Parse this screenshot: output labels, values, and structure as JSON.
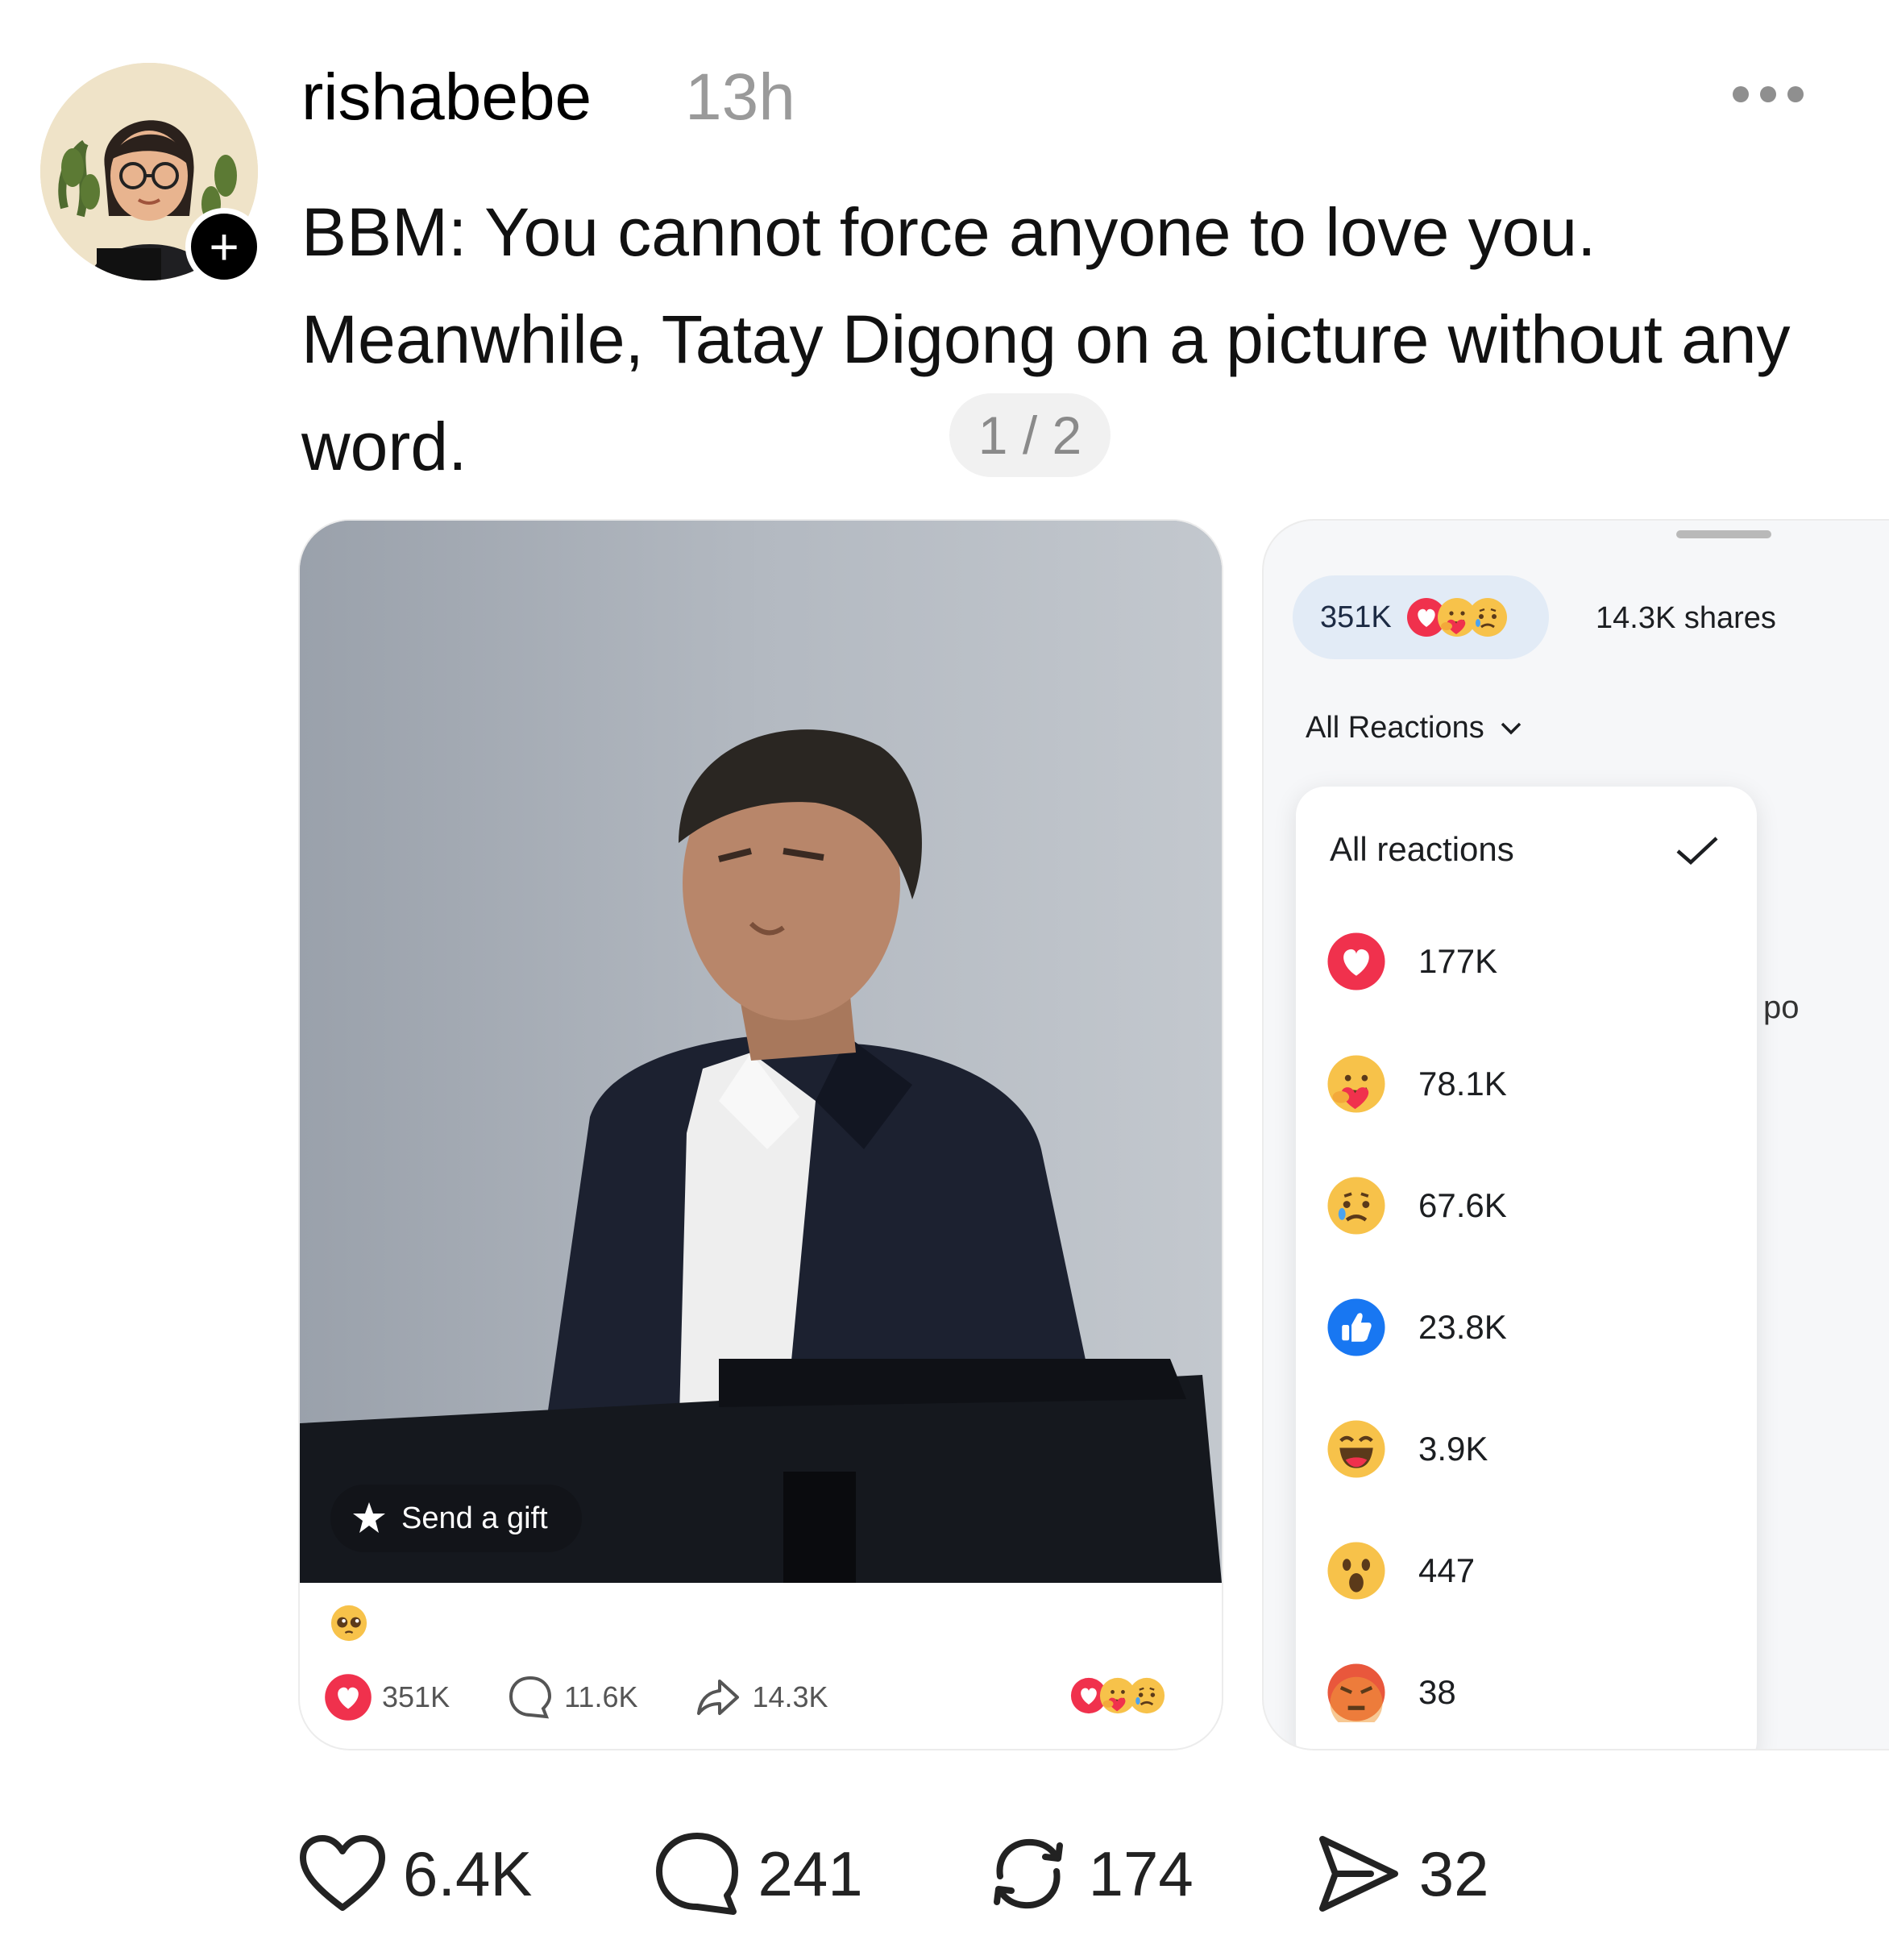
{
  "header": {
    "username": "rishabebe",
    "timestamp": "13h",
    "follow_symbol": "+"
  },
  "post": {
    "text": "BBM: You cannot force anyone to love you. Meanwhile, Tatay Digong on a picture without any word.",
    "page_indicator": "1 / 2"
  },
  "media_left": {
    "gift_button_label": "Send a gift",
    "reaction_count": "351K",
    "comment_count": "11.6K",
    "share_count": "14.3K"
  },
  "media_right": {
    "summary_count": "351K",
    "shares_label": "14.3K shares",
    "filter_label": "All Reactions",
    "partial_text": "po",
    "dropdown": {
      "title": "All reactions",
      "rows": [
        {
          "icon": "love-icon",
          "count": "177K"
        },
        {
          "icon": "care-icon",
          "count": "78.1K"
        },
        {
          "icon": "sad-icon",
          "count": "67.6K"
        },
        {
          "icon": "like-icon",
          "count": "23.8K"
        },
        {
          "icon": "haha-icon",
          "count": "3.9K"
        },
        {
          "icon": "wow-icon",
          "count": "447"
        },
        {
          "icon": "angry-icon",
          "count": "38"
        }
      ]
    }
  },
  "actions": {
    "likes": "6.4K",
    "comments": "241",
    "reposts": "174",
    "shares": "32"
  },
  "colors": {
    "love": "#f0314d",
    "like": "#1877f2",
    "emoji_yellow": "#f7c24a",
    "angry": "#e9573c"
  }
}
